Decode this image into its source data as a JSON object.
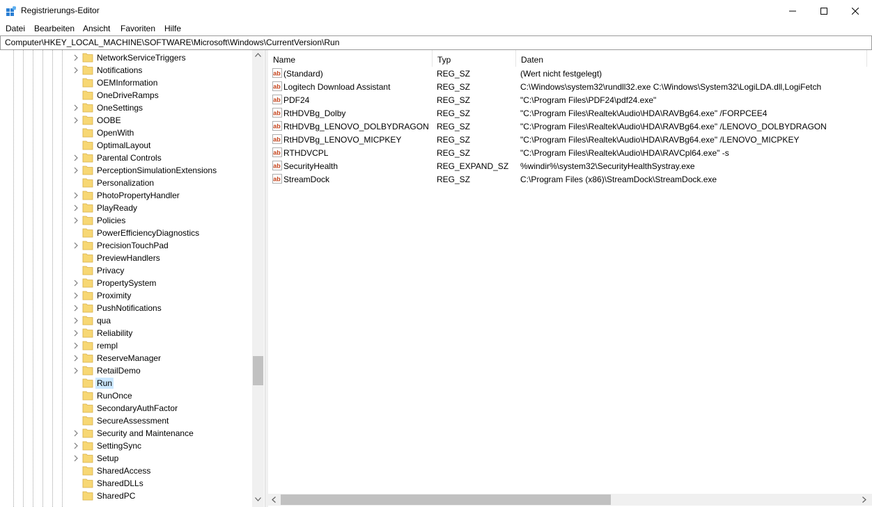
{
  "window": {
    "title": "Registrierungs-Editor",
    "minimize_glyph": "—",
    "maximize_glyph": "☐",
    "close_glyph": "✕"
  },
  "menu": [
    "Datei",
    "Bearbeiten",
    "Ansicht",
    "Favoriten",
    "Hilfe"
  ],
  "address": "Computer\\HKEY_LOCAL_MACHINE\\SOFTWARE\\Microsoft\\Windows\\CurrentVersion\\Run",
  "tree": {
    "selected": "Run",
    "items": [
      {
        "label": "NetworkServiceTriggers",
        "expandable": true
      },
      {
        "label": "Notifications",
        "expandable": true
      },
      {
        "label": "OEMInformation",
        "expandable": false
      },
      {
        "label": "OneDriveRamps",
        "expandable": false
      },
      {
        "label": "OneSettings",
        "expandable": true
      },
      {
        "label": "OOBE",
        "expandable": true
      },
      {
        "label": "OpenWith",
        "expandable": false
      },
      {
        "label": "OptimalLayout",
        "expandable": false
      },
      {
        "label": "Parental Controls",
        "expandable": true
      },
      {
        "label": "PerceptionSimulationExtensions",
        "expandable": true
      },
      {
        "label": "Personalization",
        "expandable": false
      },
      {
        "label": "PhotoPropertyHandler",
        "expandable": true
      },
      {
        "label": "PlayReady",
        "expandable": true
      },
      {
        "label": "Policies",
        "expandable": true
      },
      {
        "label": "PowerEfficiencyDiagnostics",
        "expandable": false
      },
      {
        "label": "PrecisionTouchPad",
        "expandable": true
      },
      {
        "label": "PreviewHandlers",
        "expandable": false
      },
      {
        "label": "Privacy",
        "expandable": false
      },
      {
        "label": "PropertySystem",
        "expandable": true
      },
      {
        "label": "Proximity",
        "expandable": true
      },
      {
        "label": "PushNotifications",
        "expandable": true
      },
      {
        "label": "qua",
        "expandable": true
      },
      {
        "label": "Reliability",
        "expandable": true
      },
      {
        "label": "rempl",
        "expandable": true
      },
      {
        "label": "ReserveManager",
        "expandable": true
      },
      {
        "label": "RetailDemo",
        "expandable": true
      },
      {
        "label": "Run",
        "expandable": false
      },
      {
        "label": "RunOnce",
        "expandable": false
      },
      {
        "label": "SecondaryAuthFactor",
        "expandable": false
      },
      {
        "label": "SecureAssessment",
        "expandable": false
      },
      {
        "label": "Security and Maintenance",
        "expandable": true
      },
      {
        "label": "SettingSync",
        "expandable": true
      },
      {
        "label": "Setup",
        "expandable": true
      },
      {
        "label": "SharedAccess",
        "expandable": false
      },
      {
        "label": "SharedDLLs",
        "expandable": false
      },
      {
        "label": "SharedPC",
        "expandable": false
      }
    ]
  },
  "columns": {
    "name": "Name",
    "type": "Typ",
    "data": "Daten"
  },
  "values": [
    {
      "name": "(Standard)",
      "type": "REG_SZ",
      "data": "(Wert nicht festgelegt)"
    },
    {
      "name": "Logitech Download Assistant",
      "type": "REG_SZ",
      "data": "C:\\Windows\\system32\\rundll32.exe C:\\Windows\\System32\\LogiLDA.dll,LogiFetch"
    },
    {
      "name": "PDF24",
      "type": "REG_SZ",
      "data": "\"C:\\Program Files\\PDF24\\pdf24.exe\""
    },
    {
      "name": "RtHDVBg_Dolby",
      "type": "REG_SZ",
      "data": "\"C:\\Program Files\\Realtek\\Audio\\HDA\\RAVBg64.exe\" /FORPCEE4"
    },
    {
      "name": "RtHDVBg_LENOVO_DOLBYDRAGON",
      "type": "REG_SZ",
      "data": "\"C:\\Program Files\\Realtek\\Audio\\HDA\\RAVBg64.exe\" /LENOVO_DOLBYDRAGON"
    },
    {
      "name": "RtHDVBg_LENOVO_MICPKEY",
      "type": "REG_SZ",
      "data": "\"C:\\Program Files\\Realtek\\Audio\\HDA\\RAVBg64.exe\" /LENOVO_MICPKEY"
    },
    {
      "name": "RTHDVCPL",
      "type": "REG_SZ",
      "data": "\"C:\\Program Files\\Realtek\\Audio\\HDA\\RAVCpl64.exe\" -s"
    },
    {
      "name": "SecurityHealth",
      "type": "REG_EXPAND_SZ",
      "data": "%windir%\\system32\\SecurityHealthSystray.exe"
    },
    {
      "name": "StreamDock",
      "type": "REG_SZ",
      "data": "C:\\Program Files (x86)\\StreamDock\\StreamDock.exe"
    }
  ],
  "icons": {
    "app": "registry-editor-icon",
    "value": "reg-string-value-icon"
  },
  "colors": {
    "selection": "#cce8ff",
    "folder": "#f7d774",
    "reg_icon": "#c4421a"
  }
}
